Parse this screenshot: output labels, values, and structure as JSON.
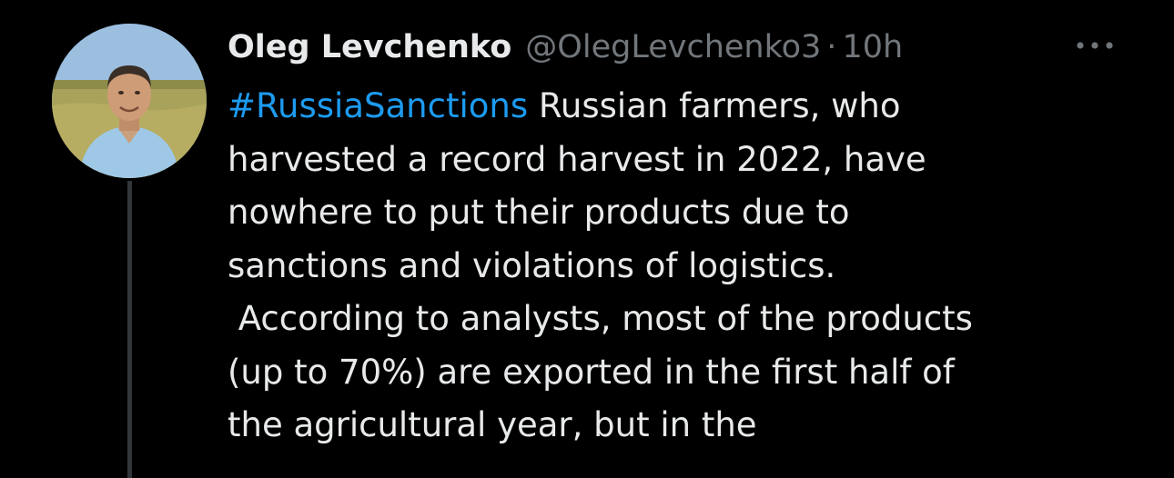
{
  "tweet": {
    "author_name": "Oleg Levchenko",
    "author_handle": "@OlegLevchenko3",
    "separator": "·",
    "time": "10h",
    "more_icon": "more-horizontal-icon",
    "hashtag": "#RussiaSanctions",
    "body": " Russian farmers, who\nharvested a record harvest in 2022, have\nnowhere to put their products due to\nsanctions and violations of logistics.\n According to analysts, most of the products\n(up to 70%) are exported in the first half of\nthe agricultural year, but in the"
  },
  "colors": {
    "background": "#000000",
    "text": "#e7e9ea",
    "secondary": "#71767b",
    "link": "#1d9bf0",
    "thread_line": "#333639"
  }
}
